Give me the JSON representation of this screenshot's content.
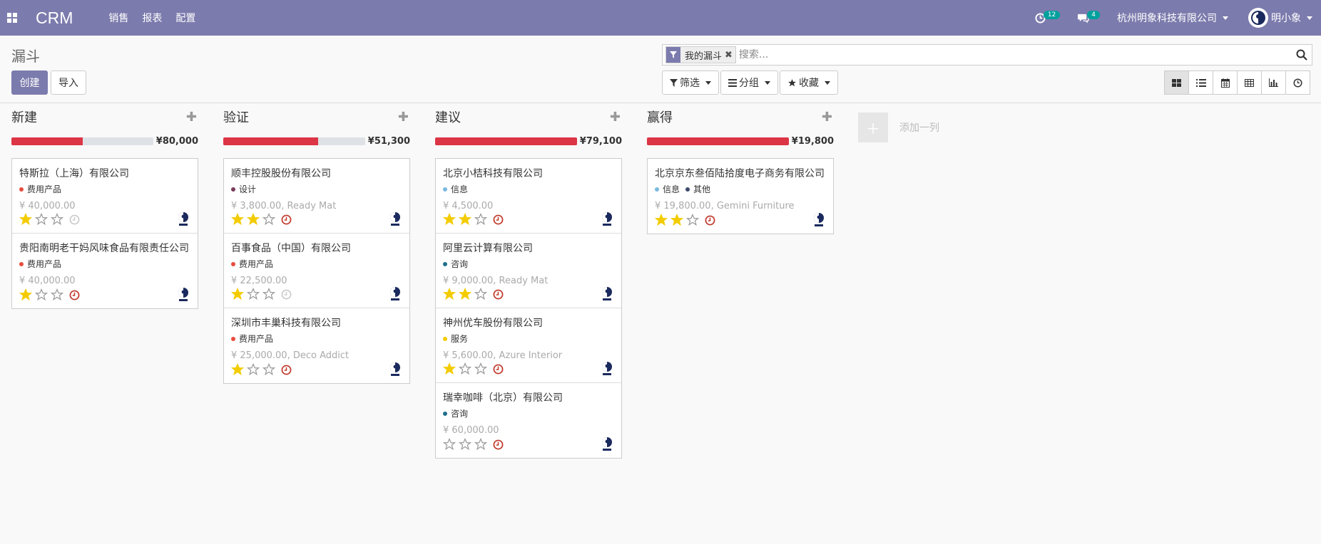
{
  "nav": {
    "brand": "CRM",
    "menu": [
      "销售",
      "报表",
      "配置"
    ],
    "activity_count": "12",
    "message_count": "4",
    "company": "杭州明象科技有限公司",
    "user": "明小象"
  },
  "panel": {
    "title": "漏斗",
    "create_label": "创建",
    "import_label": "导入",
    "facet_label": "我的漏斗",
    "search_placeholder": "搜索...",
    "filter_label": "筛选",
    "group_label": "分组",
    "favorite_label": "收藏"
  },
  "colors": {
    "navbar": "#7c7bad",
    "progress_red": "#dc3545",
    "star": "#f3cc00",
    "activity_red": "#c0392b"
  },
  "columns": [
    {
      "name": "新建",
      "sum": "¥80,000",
      "progress": 0.5,
      "cards": [
        {
          "title": "特斯拉（上海）有限公司",
          "tags": [
            {
              "label": "费用产品",
              "color": "#e74c3c"
            }
          ],
          "amount": "¥ 40,000.00",
          "stars": 1,
          "activity": "none"
        },
        {
          "title": "贵阳南明老干妈风味食品有限责任公司",
          "tags": [
            {
              "label": "费用产品",
              "color": "#e74c3c"
            }
          ],
          "amount": "¥ 40,000.00",
          "stars": 1,
          "activity": "overdue"
        }
      ]
    },
    {
      "name": "验证",
      "sum": "¥51,300",
      "progress": 0.67,
      "cards": [
        {
          "title": "顺丰控股股份有限公司",
          "tags": [
            {
              "label": "设计",
              "color": "#7a3a5b"
            }
          ],
          "amount": "¥ 3,800.00, Ready Mat",
          "stars": 2,
          "activity": "overdue"
        },
        {
          "title": "百事食品（中国）有限公司",
          "tags": [
            {
              "label": "费用产品",
              "color": "#e74c3c"
            }
          ],
          "amount": "¥ 22,500.00",
          "stars": 1,
          "activity": "none"
        },
        {
          "title": "深圳市丰巢科技有限公司",
          "tags": [
            {
              "label": "费用产品",
              "color": "#e74c3c"
            }
          ],
          "amount": "¥ 25,000.00, Deco Addict",
          "stars": 1,
          "activity": "overdue"
        }
      ]
    },
    {
      "name": "建议",
      "sum": "¥79,100",
      "progress": 1,
      "cards": [
        {
          "title": "北京小桔科技有限公司",
          "tags": [
            {
              "label": "信息",
              "color": "#7ab8e0"
            }
          ],
          "amount": "¥ 4,500.00",
          "stars": 2,
          "activity": "overdue"
        },
        {
          "title": "阿里云计算有限公司",
          "tags": [
            {
              "label": "咨询",
              "color": "#1f6f8b"
            }
          ],
          "amount": "¥ 9,000.00, Ready Mat",
          "stars": 2,
          "activity": "overdue"
        },
        {
          "title": "神州优车股份有限公司",
          "tags": [
            {
              "label": "服务",
              "color": "#f3cc00"
            }
          ],
          "amount": "¥ 5,600.00, Azure Interior",
          "stars": 1,
          "activity": "overdue"
        },
        {
          "title": "瑞幸咖啡（北京）有限公司",
          "tags": [
            {
              "label": "咨询",
              "color": "#1f6f8b"
            }
          ],
          "amount": "¥ 60,000.00",
          "stars": 0,
          "activity": "overdue"
        }
      ]
    },
    {
      "name": "赢得",
      "sum": "¥19,800",
      "progress": 1,
      "cards": [
        {
          "title": "北京京东叁佰陆拾度电子商务有限公司",
          "tags": [
            {
              "label": "信息",
              "color": "#7ab8e0"
            },
            {
              "label": "其他",
              "color": "#3d4a6b"
            }
          ],
          "amount": "¥ 19,800.00, Gemini Furniture",
          "stars": 2,
          "activity": "overdue"
        }
      ]
    }
  ],
  "add_column_label": "添加一列"
}
